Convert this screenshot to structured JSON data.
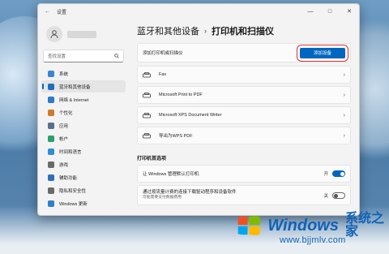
{
  "window": {
    "title": "设置",
    "controls": {
      "minimize": "—",
      "maximize": "□",
      "close": "✕"
    }
  },
  "sidebar": {
    "search_placeholder": "查找设置",
    "items": [
      {
        "label": "系统",
        "icon": "system-icon",
        "color": "#3a86d1"
      },
      {
        "label": "蓝牙和其他设备",
        "icon": "bluetooth-icon",
        "color": "#1f6fc0",
        "active": true
      },
      {
        "label": "网络 & Internet",
        "icon": "network-icon",
        "color": "#2f78c6"
      },
      {
        "label": "个性化",
        "icon": "personalization-icon",
        "color": "#d07a2a"
      },
      {
        "label": "应用",
        "icon": "apps-icon",
        "color": "#5a6f8c"
      },
      {
        "label": "帐户",
        "icon": "accounts-icon",
        "color": "#2aa06a"
      },
      {
        "label": "时间和语言",
        "icon": "time-language-icon",
        "color": "#2f8fd0"
      },
      {
        "label": "游戏",
        "icon": "gaming-icon",
        "color": "#6a6a6a"
      },
      {
        "label": "辅助功能",
        "icon": "accessibility-icon",
        "color": "#2f6fb8"
      },
      {
        "label": "隐私和安全性",
        "icon": "privacy-icon",
        "color": "#6a6a6a"
      },
      {
        "label": "Windows 更新",
        "icon": "windows-update-icon",
        "color": "#2f7fc8"
      }
    ]
  },
  "breadcrumb": {
    "parent": "蓝牙和其他设备",
    "separator": "›",
    "current": "打印机和扫描仪"
  },
  "add_printer": {
    "label": "添加打印机或扫描仪",
    "button": "添加设备"
  },
  "printers": [
    {
      "name": "Fax"
    },
    {
      "name": "Microsoft Print to PDF"
    },
    {
      "name": "Microsoft XPS Document Writer"
    },
    {
      "name": "导出为WPS PDF"
    }
  ],
  "preferences": {
    "heading": "打印机首选项",
    "item1": {
      "label": "让 Windows 管理默认打印机",
      "state": "开",
      "on": true
    },
    "item2": {
      "label": "通过按流量计费的连接下载驱动程序和设备软件",
      "sub": "可能需要支付数据费用",
      "state": "关",
      "on": false
    }
  },
  "watermark": {
    "brand": "Windows",
    "brand_cn": "系统之家",
    "url": "www.bjjmlv.com"
  }
}
